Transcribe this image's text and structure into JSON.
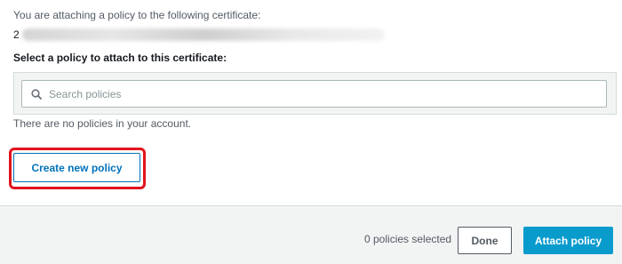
{
  "intro_text": "You are attaching a policy to the following certificate:",
  "certificate": {
    "id_prefix": "2",
    "id_redacted": true
  },
  "section_label": "Select a policy to attach to this certificate:",
  "search": {
    "placeholder": "Search policies",
    "value": "",
    "icon": "search-icon"
  },
  "empty_message": "There are no policies in your account.",
  "create_button": {
    "label": "Create new policy",
    "highlighted": true,
    "highlight_color": "#e0141e"
  },
  "footer": {
    "selected_count": "0 policies selected",
    "done_label": "Done",
    "attach_label": "Attach policy"
  },
  "colors": {
    "accent": "#0073bb",
    "primary_button": "#0a9bcd",
    "footer_bg": "#f2f3f3"
  }
}
